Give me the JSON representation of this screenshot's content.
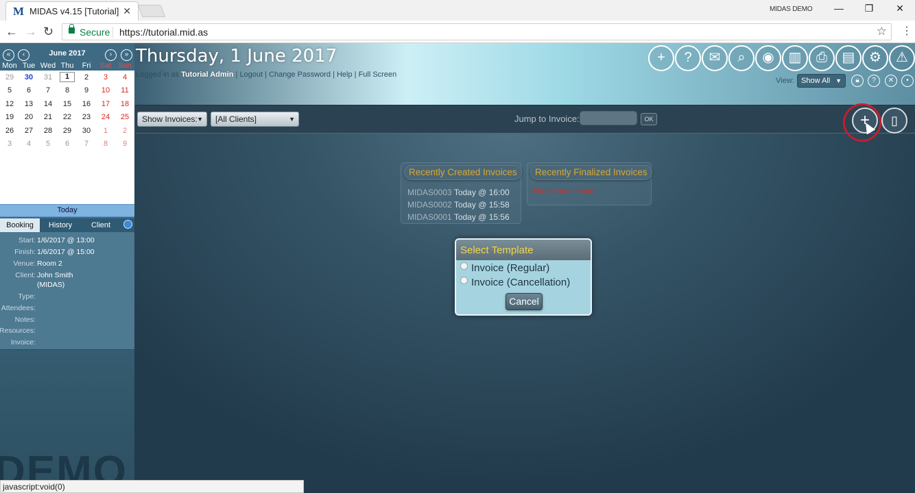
{
  "browser": {
    "tab_title": "MIDAS v4.15 [Tutorial]",
    "tab_icon": "M",
    "tab_close": "✕",
    "profile": "MIDAS DEMO",
    "secure_label": "Secure",
    "url": "https://tutorial.mid.as",
    "status_text": "javascript:void(0)"
  },
  "calendar": {
    "month": "June 2017",
    "days": [
      "Mon",
      "Tue",
      "Wed",
      "Thu",
      "Fri",
      "Sat",
      "Sun"
    ],
    "weeks": [
      [
        "29",
        "30",
        "31",
        "1",
        "2",
        "3",
        "4"
      ],
      [
        "5",
        "6",
        "7",
        "8",
        "9",
        "10",
        "11"
      ],
      [
        "12",
        "13",
        "14",
        "15",
        "16",
        "17",
        "18"
      ],
      [
        "19",
        "20",
        "21",
        "22",
        "23",
        "24",
        "25"
      ],
      [
        "26",
        "27",
        "28",
        "29",
        "30",
        "1",
        "2"
      ],
      [
        "3",
        "4",
        "5",
        "6",
        "7",
        "8",
        "9"
      ]
    ],
    "today_label": "Today"
  },
  "sidebar": {
    "tabs": [
      "Booking",
      "History",
      "Client"
    ],
    "details": {
      "start_label": "Start:",
      "start_value": "1/6/2017 @ 13:00",
      "finish_label": "Finish:",
      "finish_value": "1/6/2017 @ 15:00",
      "venue_label": "Venue:",
      "venue_value": "Room 2",
      "client_label": "Client:",
      "client_value": "John Smith",
      "client_value2": "(MIDAS)",
      "type_label": "Type:",
      "attendees_label": "Attendees:",
      "notes_label": "Notes:",
      "resources_label": "Resources:",
      "invoice_label": "Invoice:"
    },
    "watermark": "DEMO"
  },
  "header": {
    "title": "Thursday, 1 June 2017",
    "logged_in_prefix": "Logged in as",
    "user": "Tutorial Admin",
    "links": [
      "Logout",
      "Change Password",
      "Help",
      "Full Screen"
    ],
    "separator": "|",
    "view_label": "View:",
    "view_value": "Show All"
  },
  "toolbar": {
    "show_invoices": "Show Invoices:",
    "clients": "[All Clients]",
    "jump_label": "Jump to Invoice:",
    "ok": "OK"
  },
  "invoices": {
    "recent_created_title": "Recently Created Invoices",
    "recent_finalized_title": "Recently Finalized Invoices",
    "created": [
      {
        "code": "MIDAS0003",
        "time": "Today @ 16:00"
      },
      {
        "code": "MIDAS0002",
        "time": "Today @ 15:58"
      },
      {
        "code": "MIDAS0001",
        "time": "Today @ 15:56"
      }
    ],
    "no_records": "No records found"
  },
  "modal": {
    "title": "Select Template",
    "options": [
      "Invoice (Regular)",
      "Invoice (Cancellation)"
    ],
    "cancel": "Cancel"
  },
  "colors": {
    "accent_gold": "#d8a733",
    "error_red": "#c9302c",
    "highlight_ring": "#c21f2c"
  }
}
